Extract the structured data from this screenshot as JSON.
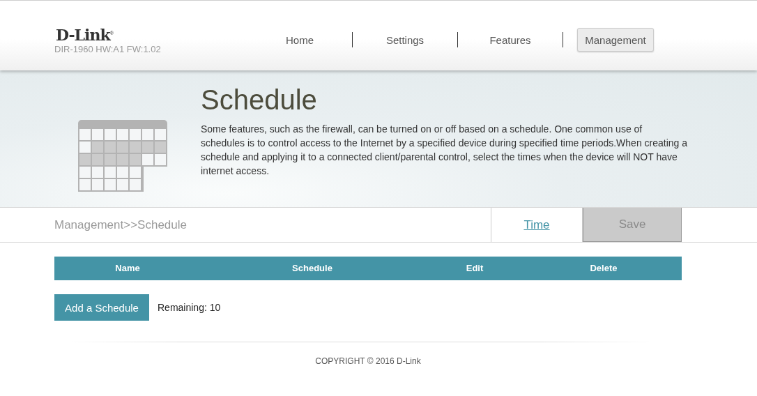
{
  "brand": {
    "logo": "D-Link$^{®}$",
    "model": "DIR-1960 HW:A1 FW:1.02"
  },
  "nav": [
    {
      "label": "Home",
      "selected": false
    },
    {
      "label": "Settings",
      "selected": false
    },
    {
      "label": "Features",
      "selected": false
    },
    {
      "label": "Management",
      "selected": true
    }
  ],
  "banner": {
    "title": "Schedule",
    "description": "Some features, such as the firewall, can be turned on or off based on a schedule. One common use of schedules is to control access to the Internet by a specified device during specified time periods.When creating a schedule and applying it to a connected client/parental control, select the times when the device will NOT have internet access."
  },
  "toolbar": {
    "breadcrumb": "Management>>Schedule",
    "buttons": [
      {
        "label": "Time",
        "kind": "link",
        "disabled": false
      },
      {
        "label": "Save",
        "kind": "button",
        "disabled": true
      }
    ]
  },
  "table": {
    "columns": [
      "Name",
      "Schedule",
      "Edit",
      "Delete"
    ]
  },
  "add_button": "Add a Schedule",
  "remaining": "Remaining: 10",
  "footer": "COPYRIGHT © 2016 D-Link"
}
